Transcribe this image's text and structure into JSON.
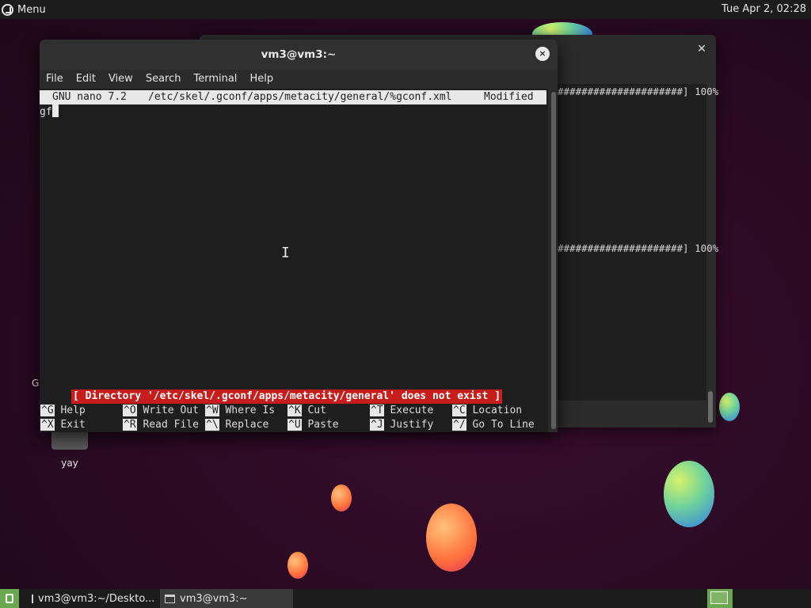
{
  "top_panel": {
    "menu_label": "Menu",
    "clock": "Tue Apr 2, 02:28"
  },
  "desktop": {
    "icon_label": "yay",
    "stray_text": "G"
  },
  "back_window": {
    "progress_lines": [
      "#####################] 100%",
      "#####################] 100%"
    ]
  },
  "nano_window": {
    "title": "vm3@vm3:~",
    "close_glyph": "×",
    "menu": [
      "File",
      "Edit",
      "View",
      "Search",
      "Terminal",
      "Help"
    ],
    "nano": {
      "version": "GNU nano 7.2",
      "path": "/etc/skel/.gconf/apps/metacity/general/%gconf.xml",
      "state": "Modified",
      "line1": "gf",
      "status_message": "[ Directory '/etc/skel/.gconf/apps/metacity/general' does not exist ]",
      "shortcuts_row1": [
        {
          "key": "^G",
          "label": "Help"
        },
        {
          "key": "^O",
          "label": "Write Out"
        },
        {
          "key": "^W",
          "label": "Where Is"
        },
        {
          "key": "^K",
          "label": "Cut"
        },
        {
          "key": "^T",
          "label": "Execute"
        },
        {
          "key": "^C",
          "label": "Location"
        }
      ],
      "shortcuts_row2": [
        {
          "key": "^X",
          "label": "Exit"
        },
        {
          "key": "^R",
          "label": "Read File"
        },
        {
          "key": "^\\",
          "label": "Replace"
        },
        {
          "key": "^U",
          "label": "Paste"
        },
        {
          "key": "^J",
          "label": "Justify"
        },
        {
          "key": "^/",
          "label": "Go To Line"
        }
      ]
    }
  },
  "taskbar": {
    "tasks": [
      "vm3@vm3:~/Deskto...",
      "vm3@vm3:~"
    ]
  },
  "colors": {
    "accent": "#6aa84f",
    "status_red": "#c81d1d",
    "background": "#2a0a23"
  }
}
